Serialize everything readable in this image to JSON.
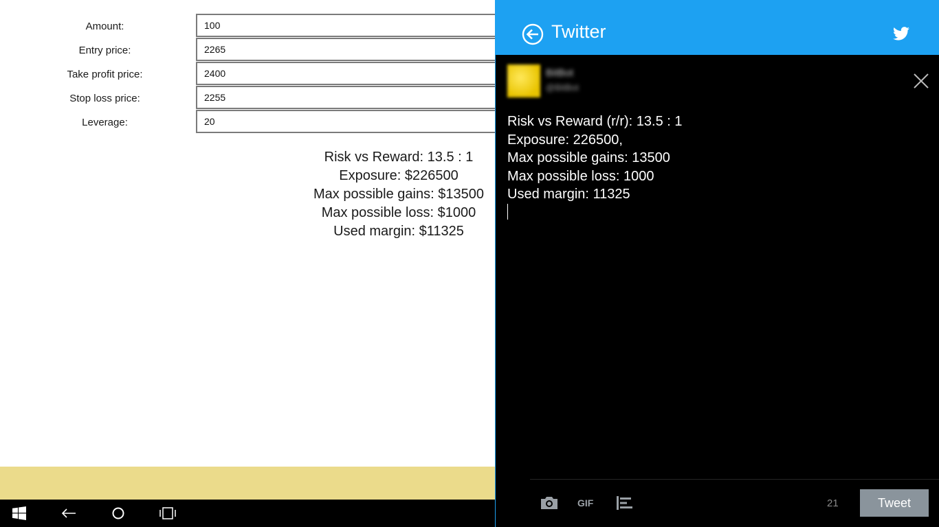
{
  "form": {
    "fields": [
      {
        "label": "Amount:",
        "value": "100"
      },
      {
        "label": "Entry price:",
        "value": "2265"
      },
      {
        "label": "Take profit price:",
        "value": "2400"
      },
      {
        "label": "Stop loss price:",
        "value": "2255"
      },
      {
        "label": "Leverage:",
        "value": "20"
      }
    ]
  },
  "results": [
    "Risk vs Reward: 13.5 : 1",
    "Exposure: $226500",
    "Max possible gains: $13500",
    "Max possible loss: $1000",
    "Used margin: $11325"
  ],
  "share": {
    "title": "Twitter",
    "account_name": "BitBot",
    "account_handle": "@BitBot",
    "tweet_lines": [
      "Risk vs Reward (r/r): 13.5 : 1",
      "Exposure: 226500,",
      "Max possible gains: 13500",
      "Max possible loss: 1000",
      "Used margin: 11325"
    ],
    "gif_label": "GIF",
    "char_count": "21",
    "tweet_button": "Tweet"
  },
  "colors": {
    "twitter_blue": "#1da1f2",
    "band_yellow": "#ebdb8b",
    "tweet_button_bg": "#8a949c"
  },
  "icons": [
    "back-arrow-icon",
    "twitter-bird-icon",
    "close-icon",
    "camera-icon",
    "gif-icon",
    "poll-icon",
    "windows-start-icon",
    "back-icon",
    "cortana-icon",
    "task-view-icon"
  ]
}
